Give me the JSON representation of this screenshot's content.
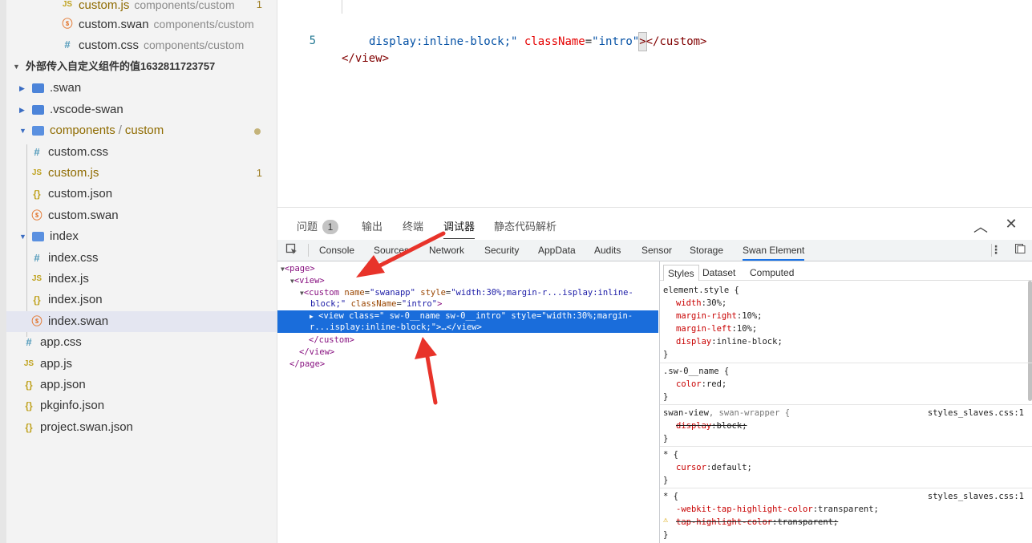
{
  "explorer": {
    "items": [
      {
        "label": "custom.js",
        "desc": "components/custom",
        "icon": "js-icon",
        "badge": "1",
        "modified": true
      },
      {
        "label": "custom.swan",
        "desc": "components/custom",
        "icon": "swan-icon"
      },
      {
        "label": "custom.css",
        "desc": "components/custom",
        "icon": "css-icon"
      },
      {
        "label": "外部传入自定义组件的值1632811723757",
        "icon": "chevron-down-icon"
      },
      {
        "label": ".swan",
        "icon": "folder-icon"
      },
      {
        "label": ".vscode-swan",
        "icon": "folder-icon"
      },
      {
        "label": "components",
        "label_suffix": "custom",
        "separator": "/",
        "icon": "folder-open-icon",
        "modified": true
      },
      {
        "label": "custom.css",
        "icon": "css-icon"
      },
      {
        "label": "custom.js",
        "icon": "js-icon",
        "badge": "1",
        "modified": true
      },
      {
        "label": "custom.json",
        "icon": "json-icon"
      },
      {
        "label": "custom.swan",
        "icon": "swan-icon"
      },
      {
        "label": "index",
        "icon": "folder-open-icon"
      },
      {
        "label": "index.css",
        "icon": "css-icon"
      },
      {
        "label": "index.js",
        "icon": "js-icon"
      },
      {
        "label": "index.json",
        "icon": "json-icon"
      },
      {
        "label": "index.swan",
        "icon": "swan-icon",
        "selected": true
      },
      {
        "label": "app.css",
        "icon": "css-icon"
      },
      {
        "label": "app.js",
        "icon": "js-icon"
      },
      {
        "label": "app.json",
        "icon": "json-icon"
      },
      {
        "label": "pkginfo.json",
        "icon": "json-icon"
      },
      {
        "label": "project.swan.json",
        "icon": "json-icon"
      }
    ],
    "icon_glyphs": {
      "css": "#",
      "js": "JS",
      "json": "{}",
      "swan": "ⓢ"
    }
  },
  "editor": {
    "line4": {
      "attr1": "display:inline-block;\"",
      "attr2_name": "className",
      "eq": "=",
      "attr2_value": "\"intro\"",
      "close_bracket": ">",
      "close_tag": "</custom>"
    },
    "line5": {
      "number": "5",
      "text": "</view>"
    }
  },
  "panel": {
    "tabs": [
      "问题",
      "输出",
      "终端",
      "调试器",
      "静态代码解析"
    ],
    "active_tab": "调试器",
    "problem_count": "1"
  },
  "devtools": {
    "tabs": [
      "Console",
      "Sources",
      "Network",
      "Security",
      "AppData",
      "Audits",
      "Sensor",
      "Storage",
      "Swan Element"
    ],
    "active_tab": "Swan Element",
    "elements": {
      "page_open": "<page>",
      "view_open": "<view>",
      "custom_open_1": "<custom",
      "custom_attr_name": "name",
      "custom_attr_name_val": "\"swanapp\"",
      "custom_attr_style": "style",
      "custom_attr_style_val": "\"width:30%;margin-r...isplay:inline-",
      "custom_attr_style_val2": "block;\"",
      "custom_attr_class": "className",
      "custom_attr_class_val": "\"intro\"",
      "custom_close": ">",
      "sel_line1": "<view class=\" sw-0__name sw-0__intro\" style=\"width:30%;margin-",
      "sel_line2": "r...isplay:inline-block;\">…</view>",
      "custom_end": "</custom>",
      "view_end": "</view>",
      "page_end": "</page>"
    },
    "styles_tabs": [
      "Styles",
      "Dataset",
      "Computed"
    ],
    "styles": {
      "element_style_selector": "element.style {",
      "element_props": [
        {
          "name": "width",
          "value": "30%;"
        },
        {
          "name": "margin-right",
          "value": "10%;"
        },
        {
          "name": "margin-left",
          "value": "10%;"
        },
        {
          "name": "display",
          "value": "inline-block;"
        }
      ],
      "rule2_selector": ".sw-0__name {",
      "rule2_props": [
        {
          "name": "color",
          "value": "red;"
        }
      ],
      "rule3_selector_a": "swan-view",
      "rule3_selector_b": ", swan-wrapper {",
      "rule3_source": "styles_slaves.css:1",
      "rule3_props": [
        {
          "name": "display",
          "value": "block;",
          "struck": true
        }
      ],
      "rule4_selector": "* {",
      "rule4_props": [
        {
          "name": "cursor",
          "value": "default;"
        }
      ],
      "rule5_selector": "* {",
      "rule5_source": "styles_slaves.css:1",
      "rule5_props": [
        {
          "name": "-webkit-tap-highlight-color",
          "value": "transparent;"
        },
        {
          "name": "tap-highlight-color",
          "value": "transparent;",
          "struck": true,
          "warning": true
        }
      ],
      "close_brace": "}"
    }
  },
  "colors": {
    "accent": "#1a73e8",
    "selection": "#1a6ddb",
    "arrow": "#e8332a"
  }
}
